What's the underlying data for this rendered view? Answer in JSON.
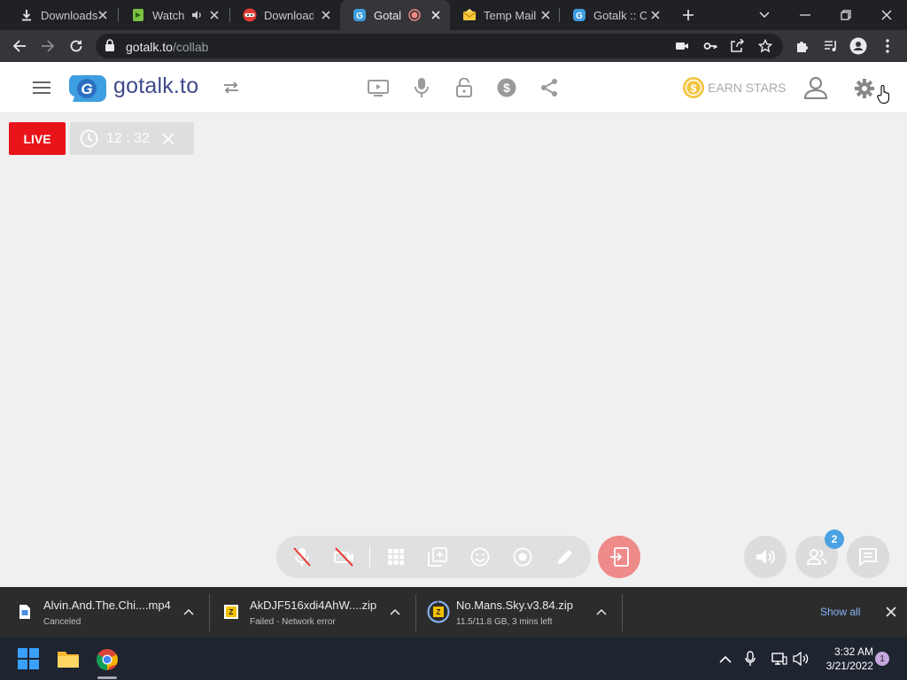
{
  "browser": {
    "tabs": [
      {
        "title": "Downloads"
      },
      {
        "title": "Watch"
      },
      {
        "title": "Download"
      },
      {
        "title": "Gotalk"
      },
      {
        "title": "Temp Mail"
      },
      {
        "title": "Gotalk :: Op"
      }
    ],
    "url_host": "gotalk.to",
    "url_path": "/collab"
  },
  "app": {
    "logo_text": "gotalk.to",
    "earn_stars_label": "EARN STARS",
    "live_label": "LIVE",
    "timer": "12 : 32",
    "participants_count": "2"
  },
  "downloads": {
    "items": [
      {
        "filename": "Alvin.And.The.Chi....mp4",
        "status": "Canceled"
      },
      {
        "filename": "AkDJF516xdi4AhW....zip",
        "status": "Failed - Network error"
      },
      {
        "filename": "No.Mans.Sky.v3.84.zip",
        "status": "11.5/11.8 GB, 3 mins left"
      }
    ],
    "show_all_label": "Show all"
  },
  "taskbar": {
    "time": "3:32 AM",
    "date": "3/21/2022",
    "notifications": "1"
  },
  "colors": {
    "live_red": "#e8141a",
    "brand_blue": "#3f4a8c",
    "leave_button": "#ef8a8a",
    "badge_blue": "#4ba3e3"
  }
}
